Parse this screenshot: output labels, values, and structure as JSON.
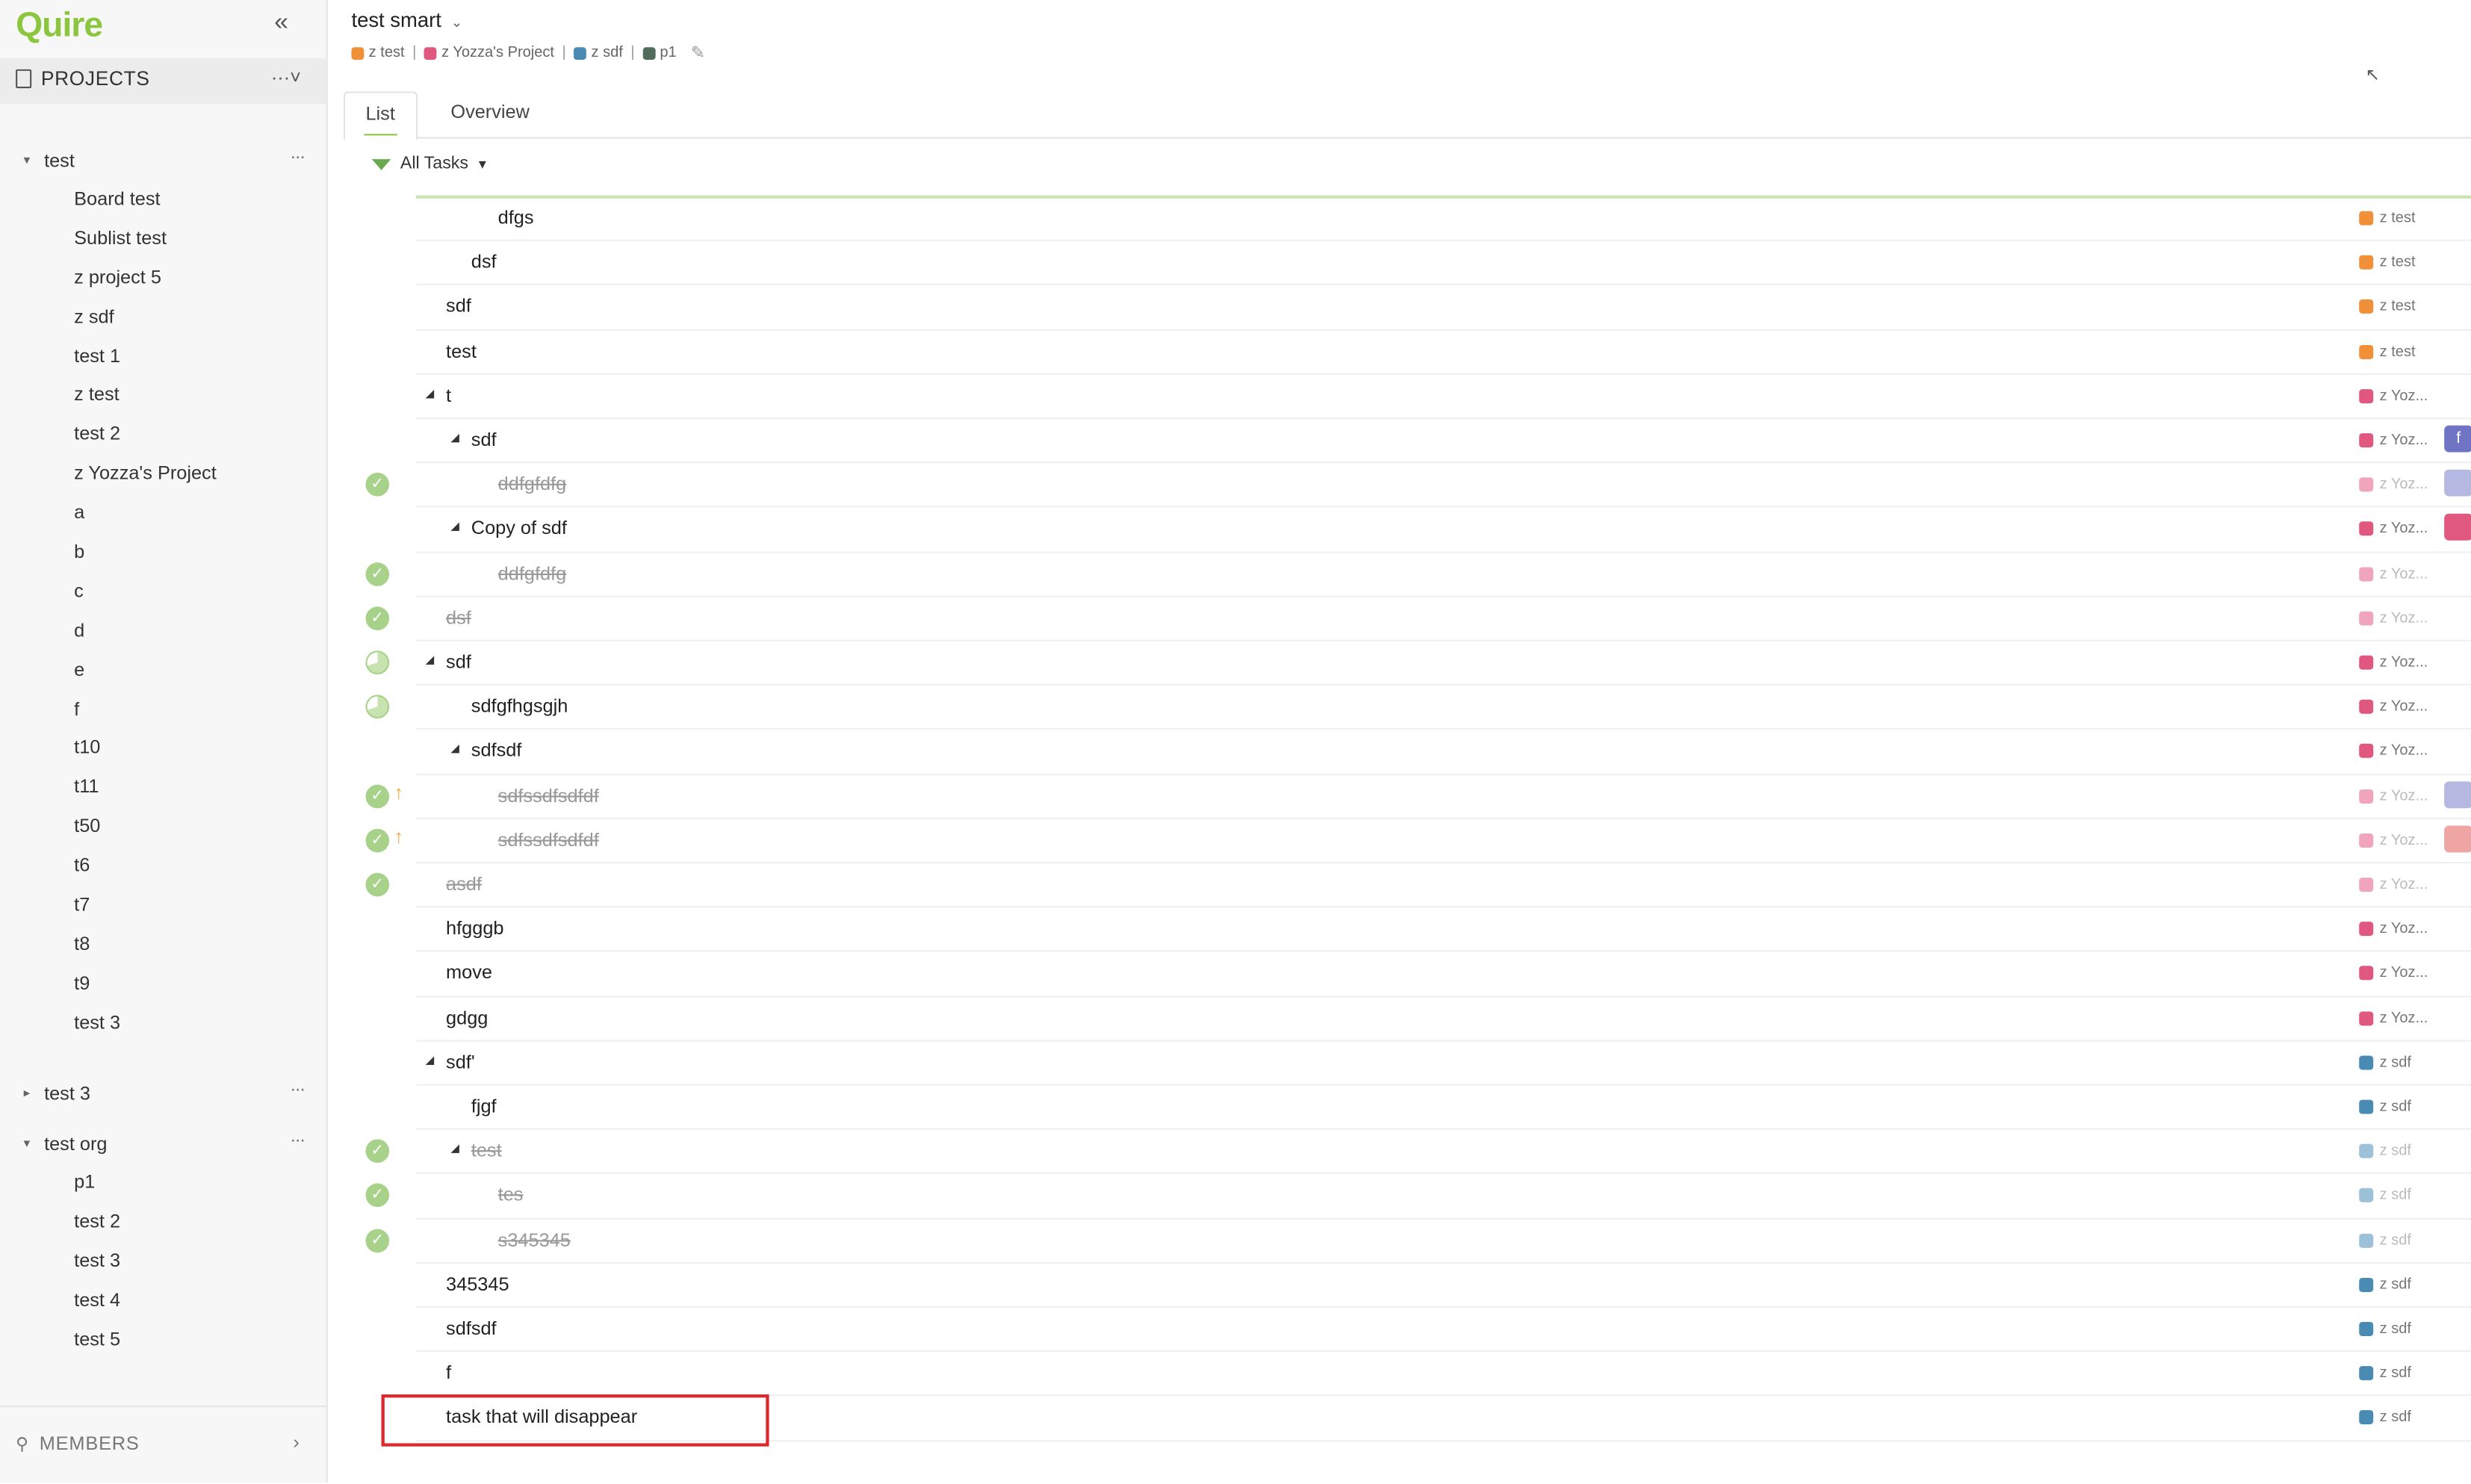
{
  "sidebar": {
    "logo": "Quire",
    "projects_label": "PROJECTS",
    "projects_menu": "···˅",
    "groups": [
      {
        "name": "test",
        "expanded": true,
        "more": "···",
        "children": [
          "Board test",
          "Sublist test",
          "z project 5",
          "z sdf",
          "test 1",
          "z test",
          "test 2",
          "z Yozza's Project",
          "a",
          "b",
          "c",
          "d",
          "e",
          "f",
          "t10",
          "t11",
          "t50",
          "t6",
          "t7",
          "t8",
          "t9",
          "test 3"
        ]
      },
      {
        "name": "test 3",
        "expanded": false,
        "more": "···",
        "children": []
      },
      {
        "name": "test org",
        "expanded": true,
        "more": "···",
        "children": [
          "p1",
          "test 2",
          "test 3",
          "test 4",
          "test 5"
        ]
      }
    ],
    "members_label": "MEMBERS"
  },
  "header": {
    "title": "test smart",
    "breadcrumbs": [
      {
        "label": "z test",
        "color": "#f0913a"
      },
      {
        "label": "z Yozza's Project",
        "color": "#e05780"
      },
      {
        "label": "z sdf",
        "color": "#4a8bb3"
      },
      {
        "label": "p1",
        "color": "#4f6b5a"
      }
    ]
  },
  "tabs": {
    "list": "List",
    "overview": "Overview"
  },
  "filter": {
    "label": "All Tasks"
  },
  "colors": {
    "ztest": "#f0913a",
    "zyozza": "#e05780",
    "zsdf": "#4a8bb3",
    "accent": "#8cc63f"
  },
  "tasks": [
    {
      "name": "dfgs",
      "indent": 3,
      "project": "z test",
      "color": "#f0913a"
    },
    {
      "name": "dsf",
      "indent": 2,
      "project": "z test",
      "color": "#f0913a"
    },
    {
      "name": "sdf",
      "indent": 1,
      "project": "z test",
      "color": "#f0913a"
    },
    {
      "name": "test",
      "indent": 1,
      "project": "z test",
      "color": "#f0913a"
    },
    {
      "name": "t",
      "indent": 1,
      "expander": true,
      "project": "z Yoz...",
      "color": "#e05780"
    },
    {
      "name": "sdf",
      "indent": 2,
      "expander": true,
      "project": "z Yoz...",
      "color": "#e05780",
      "side": {
        "color": "#6f74c4",
        "text": "f"
      }
    },
    {
      "name": "ddfgfdfg",
      "indent": 3,
      "done": true,
      "project": "z Yoz...",
      "color": "#f0a5bd",
      "side": {
        "color": "#b5b8e0",
        "text": ""
      }
    },
    {
      "name": "Copy of sdf",
      "indent": 2,
      "expander": true,
      "project": "z Yoz...",
      "color": "#e05780",
      "side": {
        "color": "#e05780",
        "text": ""
      }
    },
    {
      "name": "ddfgfdfg",
      "indent": 3,
      "done": true,
      "project": "z Yoz...",
      "color": "#f0a5bd"
    },
    {
      "name": "dsf",
      "indent": 1,
      "done": true,
      "project": "z Yoz...",
      "color": "#f0a5bd"
    },
    {
      "name": "sdf",
      "indent": 1,
      "expander": true,
      "partial": true,
      "project": "z Yoz...",
      "color": "#e05780"
    },
    {
      "name": "sdfgfhgsgjh",
      "indent": 2,
      "partial": true,
      "project": "z Yoz...",
      "color": "#e05780"
    },
    {
      "name": "sdfsdf",
      "indent": 2,
      "expander": true,
      "project": "z Yoz...",
      "color": "#e05780"
    },
    {
      "name": "sdfssdfsdfdf",
      "indent": 3,
      "done": true,
      "priority": true,
      "project": "z Yoz...",
      "color": "#f0a5bd",
      "side": {
        "color": "#b5b8e0",
        "text": ""
      }
    },
    {
      "name": "sdfssdfsdfdf",
      "indent": 3,
      "done": true,
      "priority": true,
      "project": "z Yoz...",
      "color": "#f0a5bd",
      "side": {
        "color": "#f0a5a5",
        "text": ""
      }
    },
    {
      "name": "asdf",
      "indent": 1,
      "done": true,
      "project": "z Yoz...",
      "color": "#f0a5bd"
    },
    {
      "name": "hfgggb",
      "indent": 1,
      "project": "z Yoz...",
      "color": "#e05780"
    },
    {
      "name": "move",
      "indent": 1,
      "project": "z Yoz...",
      "color": "#e05780"
    },
    {
      "name": "gdgg",
      "indent": 1,
      "project": "z Yoz...",
      "color": "#e05780"
    },
    {
      "name": "sdf'",
      "indent": 1,
      "expander": true,
      "project": "z sdf",
      "color": "#4a8bb3"
    },
    {
      "name": "fjgf",
      "indent": 2,
      "project": "z sdf",
      "color": "#4a8bb3"
    },
    {
      "name": "test",
      "indent": 2,
      "expander": true,
      "done": true,
      "project": "z sdf",
      "color": "#9cc1d8"
    },
    {
      "name": "tes",
      "indent": 3,
      "done": true,
      "project": "z sdf",
      "color": "#9cc1d8"
    },
    {
      "name": "s345345",
      "indent": 3,
      "done": true,
      "project": "z sdf",
      "color": "#9cc1d8"
    },
    {
      "name": "345345",
      "indent": 1,
      "project": "z sdf",
      "color": "#4a8bb3"
    },
    {
      "name": "sdfsdf",
      "indent": 1,
      "project": "z sdf",
      "color": "#4a8bb3"
    },
    {
      "name": "f",
      "indent": 1,
      "project": "z sdf",
      "color": "#4a8bb3"
    },
    {
      "name": "task that will disappear",
      "indent": 1,
      "project": "z sdf",
      "color": "#4a8bb3",
      "highlighted": true
    }
  ]
}
